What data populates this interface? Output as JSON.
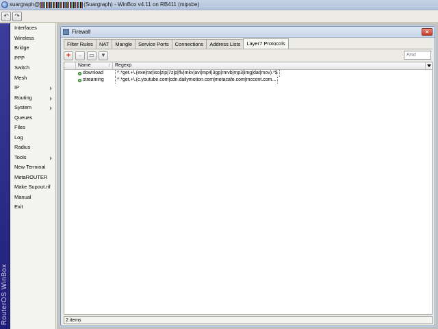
{
  "window": {
    "title_user": "suargraph@",
    "title_rest": "(Suargraph) - WinBox v4.11 on RB411 (mipsbe)"
  },
  "toolbar": {
    "undo_icon": "undo-icon",
    "redo_icon": "redo-icon"
  },
  "brand": {
    "text": "RouterOS WinBox"
  },
  "menu": {
    "items": [
      {
        "label": "Interfaces",
        "submenu": false
      },
      {
        "label": "Wireless",
        "submenu": false
      },
      {
        "label": "Bridge",
        "submenu": false
      },
      {
        "label": "PPP",
        "submenu": false
      },
      {
        "label": "Switch",
        "submenu": false
      },
      {
        "label": "Mesh",
        "submenu": false
      },
      {
        "label": "IP",
        "submenu": true
      },
      {
        "label": "Routing",
        "submenu": true
      },
      {
        "label": "System",
        "submenu": true
      },
      {
        "label": "Queues",
        "submenu": false
      },
      {
        "label": "Files",
        "submenu": false
      },
      {
        "label": "Log",
        "submenu": false
      },
      {
        "label": "Radius",
        "submenu": false
      },
      {
        "label": "Tools",
        "submenu": true
      },
      {
        "label": "New Terminal",
        "submenu": false
      },
      {
        "label": "MetaROUTER",
        "submenu": false
      },
      {
        "label": "Make Supout.rif",
        "submenu": false
      },
      {
        "label": "Manual",
        "submenu": false
      },
      {
        "label": "Exit",
        "submenu": false
      }
    ]
  },
  "firewall": {
    "title": "Firewall",
    "close_label": "×",
    "tabs": [
      {
        "label": "Filter Rules",
        "active": false
      },
      {
        "label": "NAT",
        "active": false
      },
      {
        "label": "Mangle",
        "active": false
      },
      {
        "label": "Service Ports",
        "active": false
      },
      {
        "label": "Connections",
        "active": false
      },
      {
        "label": "Address Lists",
        "active": false
      },
      {
        "label": "Layer7 Protocols",
        "active": true
      }
    ],
    "actions": {
      "add": "+",
      "remove": "−",
      "comment": "▭",
      "filter": "▼"
    },
    "find_placeholder": "Find",
    "columns": {
      "name": "Name",
      "sort": "/",
      "regexp": "Regexp"
    },
    "rows": [
      {
        "name": "download",
        "regexp": "^.*get.+\\.(exe|rar|iso|zip|7z|p|flv|mkv|avi|mp4|3gp|rmvb|mp3|img|dat|mov).*$"
      },
      {
        "name": "streaming",
        "regexp": "^.*get.+\\.(c.youtube.com|cdn.dailymotion.com|metacafe.com|mccont.com..."
      }
    ],
    "status": "2 items"
  }
}
